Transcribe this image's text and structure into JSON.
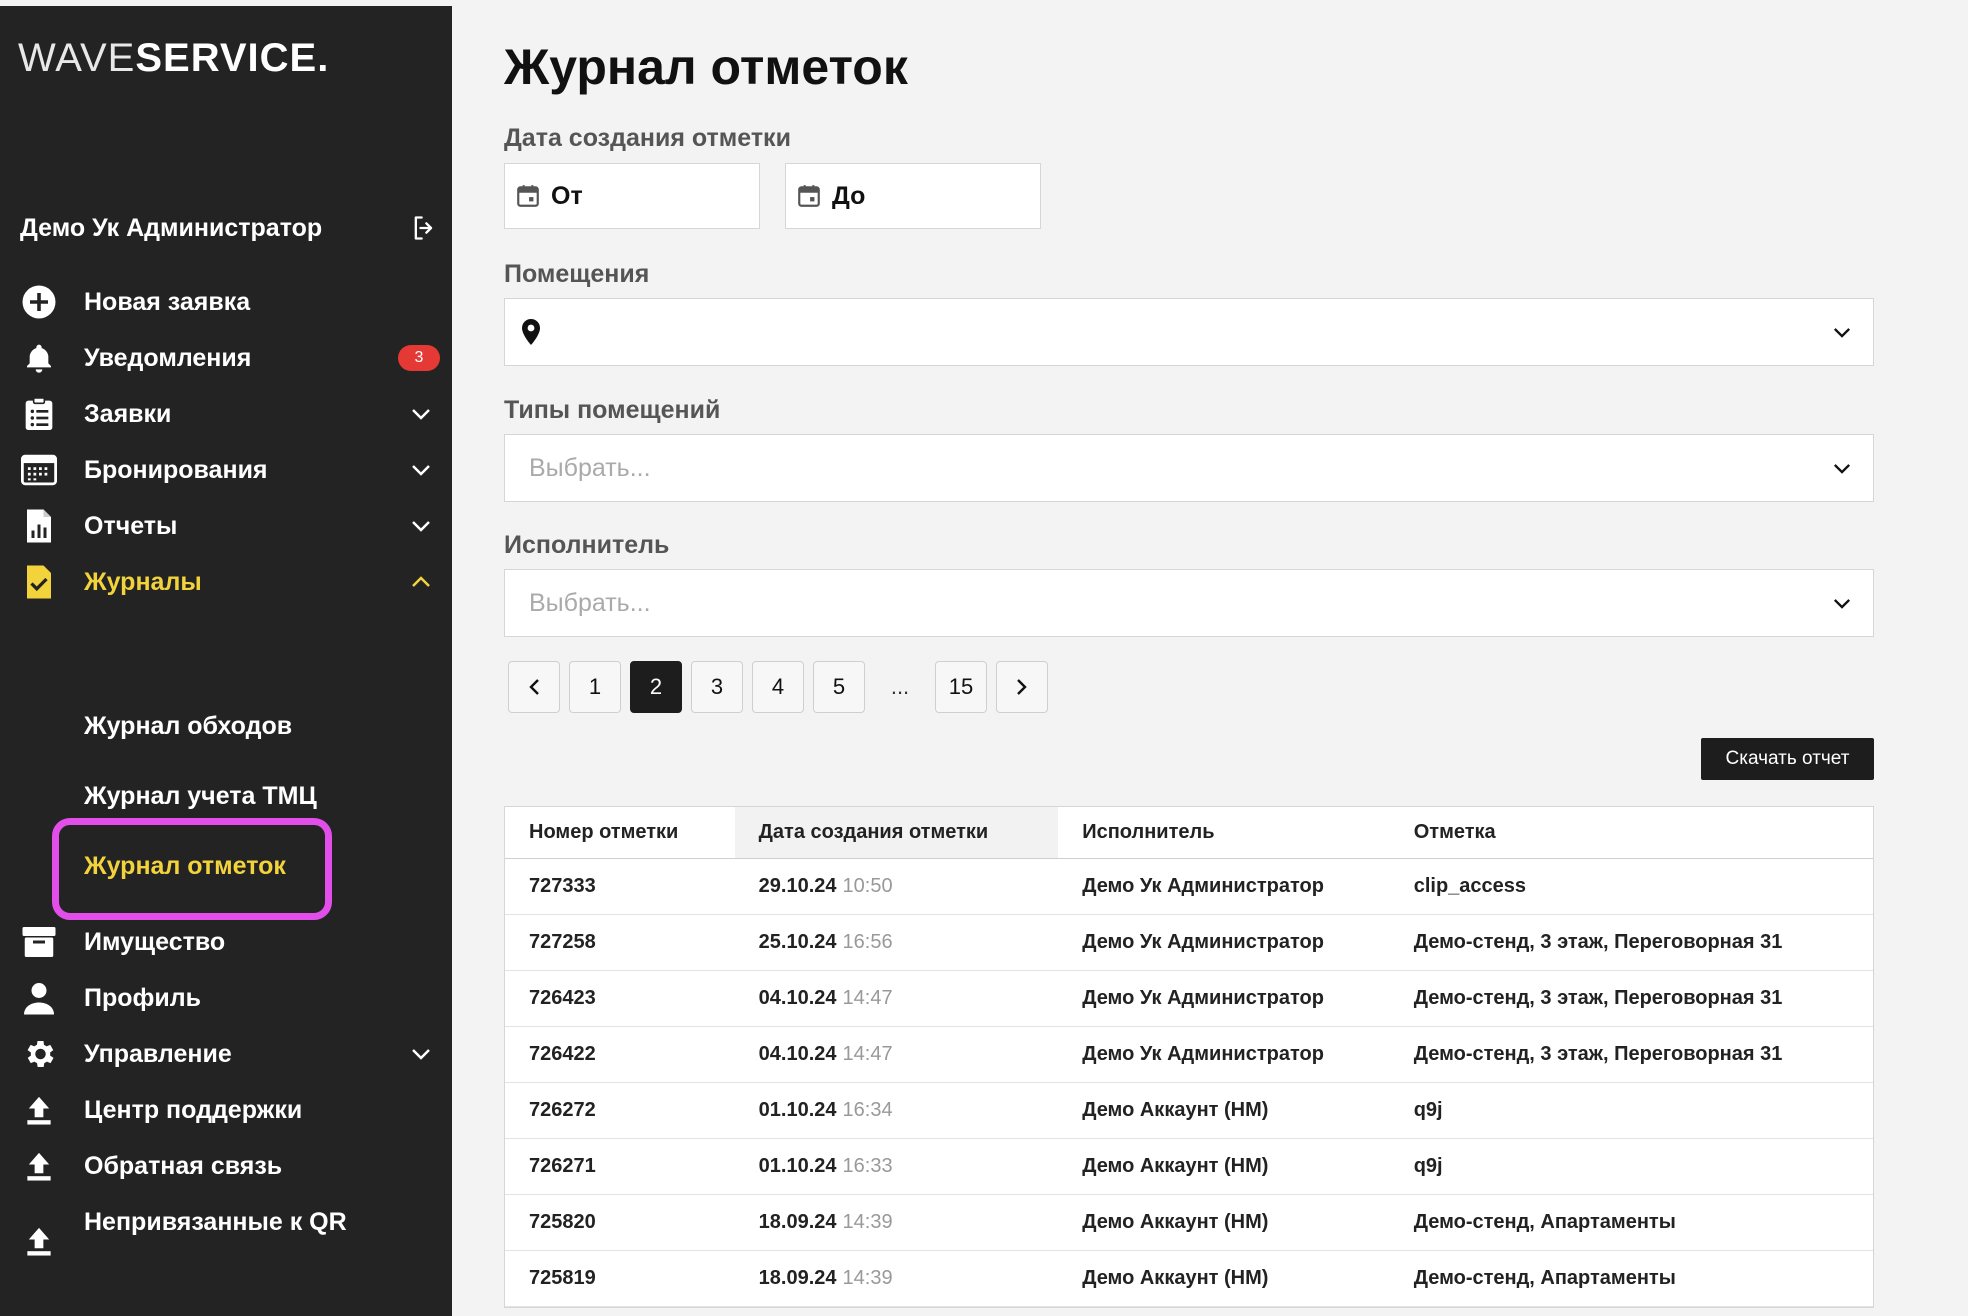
{
  "brand": {
    "logo_thin": "WAVE",
    "logo_bold": "SERVICE."
  },
  "user": {
    "name": "Демо Ук Администратор"
  },
  "sidebar": {
    "items": [
      {
        "label": "Новая заявка",
        "icon": "plus-circle-icon"
      },
      {
        "label": "Уведомления",
        "icon": "bell-icon",
        "badge": "3"
      },
      {
        "label": "Заявки",
        "icon": "clipboard-list-icon"
      },
      {
        "label": "Бронирования",
        "icon": "calendar-grid-icon"
      },
      {
        "label": "Отчеты",
        "icon": "report-chart-icon"
      },
      {
        "label": "Журналы",
        "icon": "journal-check-icon"
      },
      {
        "label": "Имущество",
        "icon": "archive-box-icon"
      },
      {
        "label": "Профиль",
        "icon": "person-icon"
      },
      {
        "label": "Управление",
        "icon": "gear-icon"
      },
      {
        "label": "Центр поддержки",
        "icon": "upload-icon"
      },
      {
        "label": "Обратная связь",
        "icon": "upload-icon"
      },
      {
        "label": "Непривязанные к QR",
        "icon": "upload-icon"
      }
    ],
    "journal_sub": [
      {
        "label": "Журнал обходов"
      },
      {
        "label": "Журнал учета ТМЦ"
      },
      {
        "label": "Журнал отметок"
      }
    ]
  },
  "main": {
    "title": "Журнал отметок",
    "date_label": "Дата создания отметки",
    "date_from": "От",
    "date_to": "До",
    "rooms_label": "Помещения",
    "room_types_label": "Типы помещений",
    "room_types_placeholder": "Выбрать...",
    "executor_label": "Исполнитель",
    "executor_placeholder": "Выбрать...",
    "download_label": "Скачать отчет"
  },
  "pagination": {
    "pages": [
      "1",
      "2",
      "3",
      "4",
      "5"
    ],
    "ellipsis": "...",
    "last": "15",
    "current": "2"
  },
  "table": {
    "headers": [
      "Номер отметки",
      "Дата создания отметки",
      "Исполнитель",
      "Отметка"
    ],
    "rows": [
      {
        "id": "727333",
        "date": "29.10.24",
        "time": "10:50",
        "executor": "Демо Ук Администратор",
        "mark": "clip_access"
      },
      {
        "id": "727258",
        "date": "25.10.24",
        "time": "16:56",
        "executor": "Демо Ук Администратор",
        "mark": "Демо-стенд, 3 этаж, Переговорная 31"
      },
      {
        "id": "726423",
        "date": "04.10.24",
        "time": "14:47",
        "executor": "Демо Ук Администратор",
        "mark": "Демо-стенд, 3 этаж, Переговорная 31"
      },
      {
        "id": "726422",
        "date": "04.10.24",
        "time": "14:47",
        "executor": "Демо Ук Администратор",
        "mark": "Демо-стенд, 3 этаж, Переговорная 31"
      },
      {
        "id": "726272",
        "date": "01.10.24",
        "time": "16:34",
        "executor": "Демо Аккаунт (НМ)",
        "mark": "q9j"
      },
      {
        "id": "726271",
        "date": "01.10.24",
        "time": "16:33",
        "executor": "Демо Аккаунт (НМ)",
        "mark": "q9j"
      },
      {
        "id": "725820",
        "date": "18.09.24",
        "time": "14:39",
        "executor": "Демо Аккаунт (НМ)",
        "mark": "Демо-стенд, Апартаменты"
      },
      {
        "id": "725819",
        "date": "18.09.24",
        "time": "14:39",
        "executor": "Демо Аккаунт (НМ)",
        "mark": "Демо-стенд, Апартаменты"
      }
    ]
  },
  "colors": {
    "sidebar_bg": "#232323",
    "accent_yellow": "#f3d33b",
    "highlight_magenta": "#e14ee9",
    "badge_red": "#e53935"
  }
}
